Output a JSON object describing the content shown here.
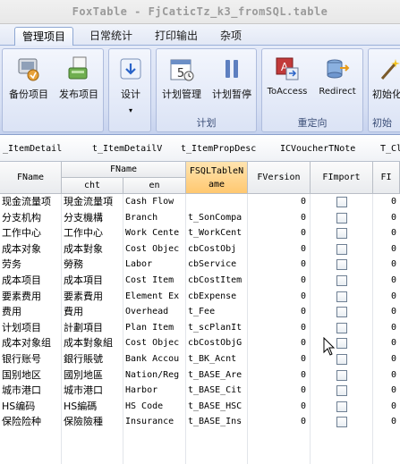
{
  "window": {
    "title": "FoxTable - FjCaticTz_k3_fromSQL.table"
  },
  "tabs": [
    {
      "label": "管理项目",
      "active": true
    },
    {
      "label": "日常统计",
      "active": false
    },
    {
      "label": "打印输出",
      "active": false
    },
    {
      "label": "杂项",
      "active": false
    }
  ],
  "ribbon": {
    "group1": {
      "label": "",
      "buttons": [
        "备份项目",
        "发布项目"
      ]
    },
    "group2": {
      "label": "",
      "buttons": [
        "设计"
      ]
    },
    "group3": {
      "label": "计划",
      "buttons": [
        "计划管理",
        "计划暂停"
      ]
    },
    "group4": {
      "label": "重定向",
      "buttons": [
        "ToAccess",
        "Redirect"
      ]
    },
    "group5": {
      "label": "初始",
      "buttons": [
        "初始化"
      ]
    }
  },
  "table_tabs": [
    "_ItemDetail",
    "t_ItemDetailV",
    "t_ItemPropDesc",
    "ICVoucherTNote",
    "T_Cl"
  ],
  "grid": {
    "headers": {
      "col1": "FName",
      "group": "FName",
      "sub_cht": "cht",
      "sub_en": "en",
      "sql_table": "FSQLTableN\name",
      "version": "FVersion",
      "import": "FImport",
      "last": "FI"
    },
    "rows": [
      {
        "a": "现金流量项",
        "b": "現金流量項",
        "en": "Cash Flow",
        "t": "",
        "v": "0"
      },
      {
        "a": "分支机构",
        "b": "分支機構",
        "en": "Branch",
        "t": "t_SonCompa",
        "v": "0"
      },
      {
        "a": "工作中心",
        "b": "工作中心",
        "en": "Work Cente",
        "t": "t_WorkCent",
        "v": "0"
      },
      {
        "a": "成本对象",
        "b": "成本對象",
        "en": "Cost Objec",
        "t": "cbCostObj",
        "v": "0"
      },
      {
        "a": "劳务",
        "b": "勞務",
        "en": "Labor",
        "t": "cbService",
        "v": "0"
      },
      {
        "a": "成本项目",
        "b": "成本項目",
        "en": "Cost Item",
        "t": "cbCostItem",
        "v": "0"
      },
      {
        "a": "要素费用",
        "b": "要素費用",
        "en": "Element Ex",
        "t": "cbExpense",
        "v": "0"
      },
      {
        "a": "费用",
        "b": "費用",
        "en": "Overhead",
        "t": "t_Fee",
        "v": "0"
      },
      {
        "a": "计划项目",
        "b": "計劃項目",
        "en": "Plan Item",
        "t": "t_scPlanIt",
        "v": "0"
      },
      {
        "a": "成本对象组",
        "b": "成本對象組",
        "en": "Cost Objec",
        "t": "cbCostObjG",
        "v": "0"
      },
      {
        "a": "银行账号",
        "b": "銀行賬號",
        "en": "Bank Accou",
        "t": "t_BK_Acnt",
        "v": "0"
      },
      {
        "a": "国别地区",
        "b": "國別地區",
        "en": "Nation/Reg",
        "t": "t_BASE_Are",
        "v": "0"
      },
      {
        "a": "城市港口",
        "b": "城市港口",
        "en": "Harbor",
        "t": "t_BASE_Cit",
        "v": "0"
      },
      {
        "a": "HS编码",
        "b": "HS編碼",
        "en": "HS Code",
        "t": "t_BASE_HSC",
        "v": "0"
      },
      {
        "a": "保险险种",
        "b": "保險險種",
        "en": "Insurance",
        "t": "t_BASE_Ins",
        "v": "0"
      }
    ],
    "last_col_value": "0"
  },
  "colors": {
    "accent": "#8ea7d2",
    "selected_header": "#ffc870"
  }
}
